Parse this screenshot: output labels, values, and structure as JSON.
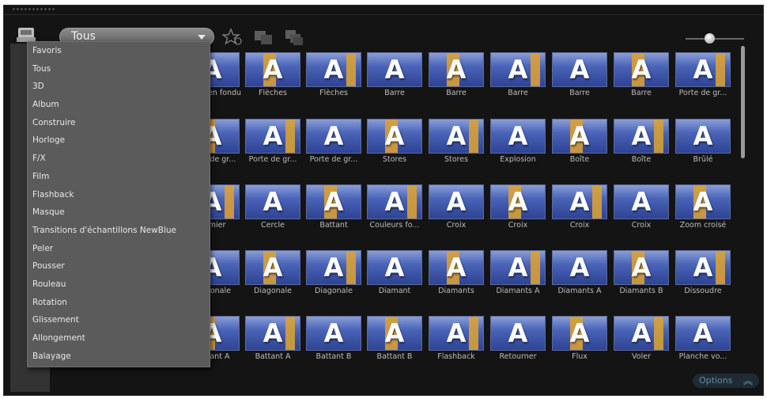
{
  "toolbar": {
    "category_value": "Tous"
  },
  "menu": {
    "items": [
      "Favoris",
      "Tous",
      "3D",
      "Album",
      "Construire",
      "Horloge",
      "F/X",
      "Film",
      "Flashback",
      "Masque",
      "Transitions d'échantillons NewBlue",
      "Peler",
      "Pousser",
      "Rouleau",
      "Rotation",
      "Glissement",
      "Allongement",
      "Balayage"
    ]
  },
  "grid": {
    "rows": [
      [
        "Fondu en fondu",
        "Flèches",
        "Flèches",
        "Barre",
        "Barre",
        "Barre",
        "Barre",
        "Barre",
        "Porte de gr..."
      ],
      [
        "Porte de gr...",
        "Porte de gr...",
        "Porte de gr...",
        "Stores",
        "Stores",
        "Explosion",
        "Boîte",
        "Boîte",
        "Brûlé"
      ],
      [
        "Damier",
        "Cercle",
        "Battant",
        "Couleurs fo...",
        "Croix",
        "Croix",
        "Croix",
        "Croix",
        "Zoom croisé"
      ],
      [
        "Diagonale",
        "Diagonale",
        "Diagonale",
        "Diamant",
        "Diamants",
        "Diamants A",
        "Diamants A",
        "Diamants B",
        "Dissoudre"
      ],
      [
        "Battant A",
        "Battant A",
        "Battant B",
        "Battant B",
        "Flashback",
        "Retourner",
        "Flux",
        "Voler",
        "Planche vo..."
      ]
    ],
    "visible_captions_first_col": [
      "Fondu en fondu",
      "Porte de gr...",
      "Damier",
      "Diagonale",
      "Battant A"
    ]
  },
  "footer": {
    "options_label": "Options"
  },
  "colors": {
    "panel_bg": "#141414",
    "thumb_blue": "#4a64b7",
    "accent_orange": "#d8a036"
  }
}
